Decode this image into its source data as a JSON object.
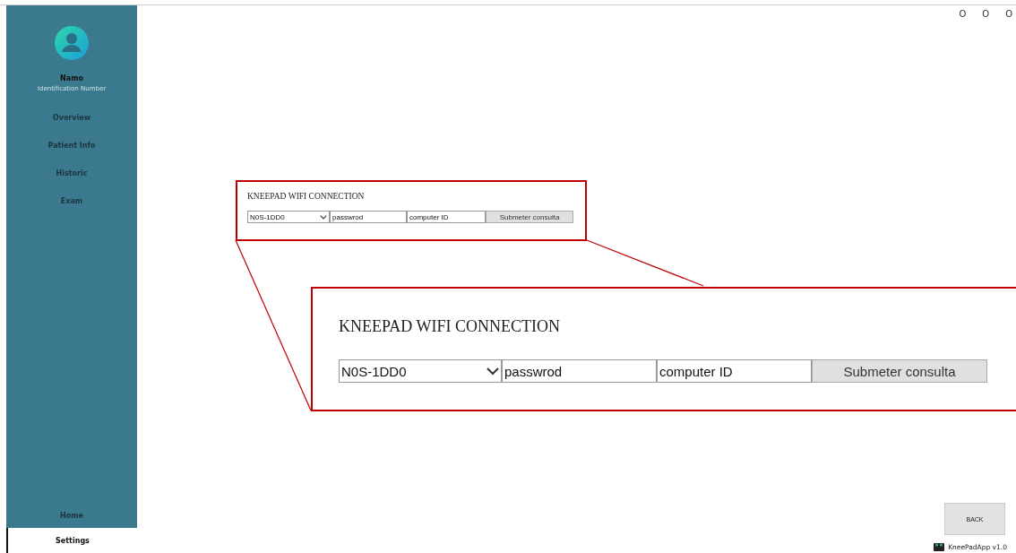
{
  "sidebar": {
    "user_name": "Namo",
    "user_id": "Identification Number",
    "items": [
      {
        "label": "Overview",
        "selected": false
      },
      {
        "label": "Patient Info",
        "selected": false
      },
      {
        "label": "Historic",
        "selected": false
      },
      {
        "label": "Exam",
        "selected": false
      }
    ],
    "bottom_items": [
      {
        "label": "Home",
        "selected": false
      },
      {
        "label": "Settings",
        "selected": true
      }
    ]
  },
  "window_controls": [
    "O",
    "O",
    "O"
  ],
  "wifi_form": {
    "title": "KNEEPAD WIFI CONNECTION",
    "network": "N0S-1DD0",
    "password": "passwrod",
    "computer_id": "computer ID",
    "submit": "Submeter consulta"
  },
  "wifi_form_zoomed": {
    "title": "KNEEPAD WIFI CONNECTION",
    "network": "N0S-1DD0",
    "password": "passwrod",
    "computer_id": "computer ID",
    "submit": "Submeter consulta"
  },
  "back_button": "BACK",
  "footer": "KneePadApp v1.0"
}
